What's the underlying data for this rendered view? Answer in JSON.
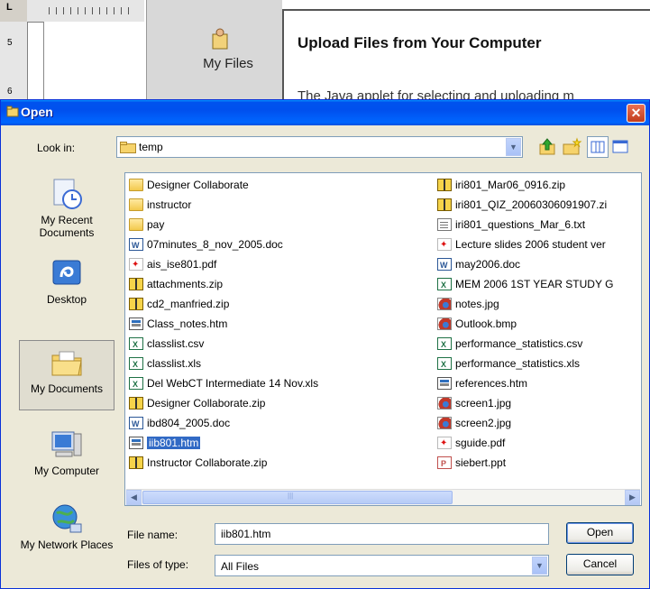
{
  "background": {
    "ruler_corner": "L",
    "side_ruler_marks": [
      "5",
      "6"
    ],
    "panel_label": "My Files",
    "heading": "Upload Files from Your Computer",
    "paragraph": "The Java applet for selecting and uploading m"
  },
  "dialog": {
    "title": "Open",
    "close_glyph": "✕",
    "look_in_label": "Look in:",
    "look_in_value": "temp",
    "places": [
      {
        "label": "My Recent Documents",
        "icon": "recent-documents-icon"
      },
      {
        "label": "Desktop",
        "icon": "desktop-icon"
      },
      {
        "label": "My Documents",
        "icon": "my-documents-icon",
        "selected": true
      },
      {
        "label": "My Computer",
        "icon": "my-computer-icon"
      },
      {
        "label": "My Network Places",
        "icon": "network-places-icon"
      }
    ],
    "files_col1": [
      {
        "name": "Designer Collaborate",
        "type": "folder"
      },
      {
        "name": "instructor",
        "type": "folder"
      },
      {
        "name": "pay",
        "type": "folder"
      },
      {
        "name": "07minutes_8_nov_2005.doc",
        "type": "doc"
      },
      {
        "name": "ais_ise801.pdf",
        "type": "pdf"
      },
      {
        "name": "attachments.zip",
        "type": "zip"
      },
      {
        "name": "cd2_manfried.zip",
        "type": "zip"
      },
      {
        "name": "Class_notes.htm",
        "type": "htm"
      },
      {
        "name": "classlist.csv",
        "type": "xls"
      },
      {
        "name": "classlist.xls",
        "type": "xls"
      },
      {
        "name": "Del WebCT Intermediate 14 Nov.xls",
        "type": "xls"
      },
      {
        "name": "Designer Collaborate.zip",
        "type": "zip"
      },
      {
        "name": "ibd804_2005.doc",
        "type": "doc"
      },
      {
        "name": "iib801.htm",
        "type": "htm",
        "selected": true
      },
      {
        "name": "Instructor Collaborate.zip",
        "type": "zip"
      }
    ],
    "files_col2": [
      {
        "name": "iri801_Mar06_0916.zip",
        "type": "zip"
      },
      {
        "name": "iri801_QIZ_20060306091907.zi",
        "type": "zip"
      },
      {
        "name": "iri801_questions_Mar_6.txt",
        "type": "txt"
      },
      {
        "name": "Lecture slides 2006 student ver",
        "type": "pdf"
      },
      {
        "name": "may2006.doc",
        "type": "doc"
      },
      {
        "name": "MEM 2006 1ST YEAR STUDY G",
        "type": "xls"
      },
      {
        "name": "notes.jpg",
        "type": "img"
      },
      {
        "name": "Outlook.bmp",
        "type": "img"
      },
      {
        "name": "performance_statistics.csv",
        "type": "xls"
      },
      {
        "name": "performance_statistics.xls",
        "type": "xls"
      },
      {
        "name": "references.htm",
        "type": "htm"
      },
      {
        "name": "screen1.jpg",
        "type": "img"
      },
      {
        "name": "screen2.jpg",
        "type": "img"
      },
      {
        "name": "sguide.pdf",
        "type": "pdf"
      },
      {
        "name": "siebert.ppt",
        "type": "ppt"
      }
    ],
    "file_name_label": "File name:",
    "file_name_value": "iib801.htm",
    "file_type_label": "Files of type:",
    "file_type_value": "All Files",
    "open_label": "Open",
    "cancel_label": "Cancel"
  },
  "colors": {
    "titlebar": "#0054e3",
    "dialog_bg": "#ece9d8",
    "selection": "#316ac5"
  }
}
